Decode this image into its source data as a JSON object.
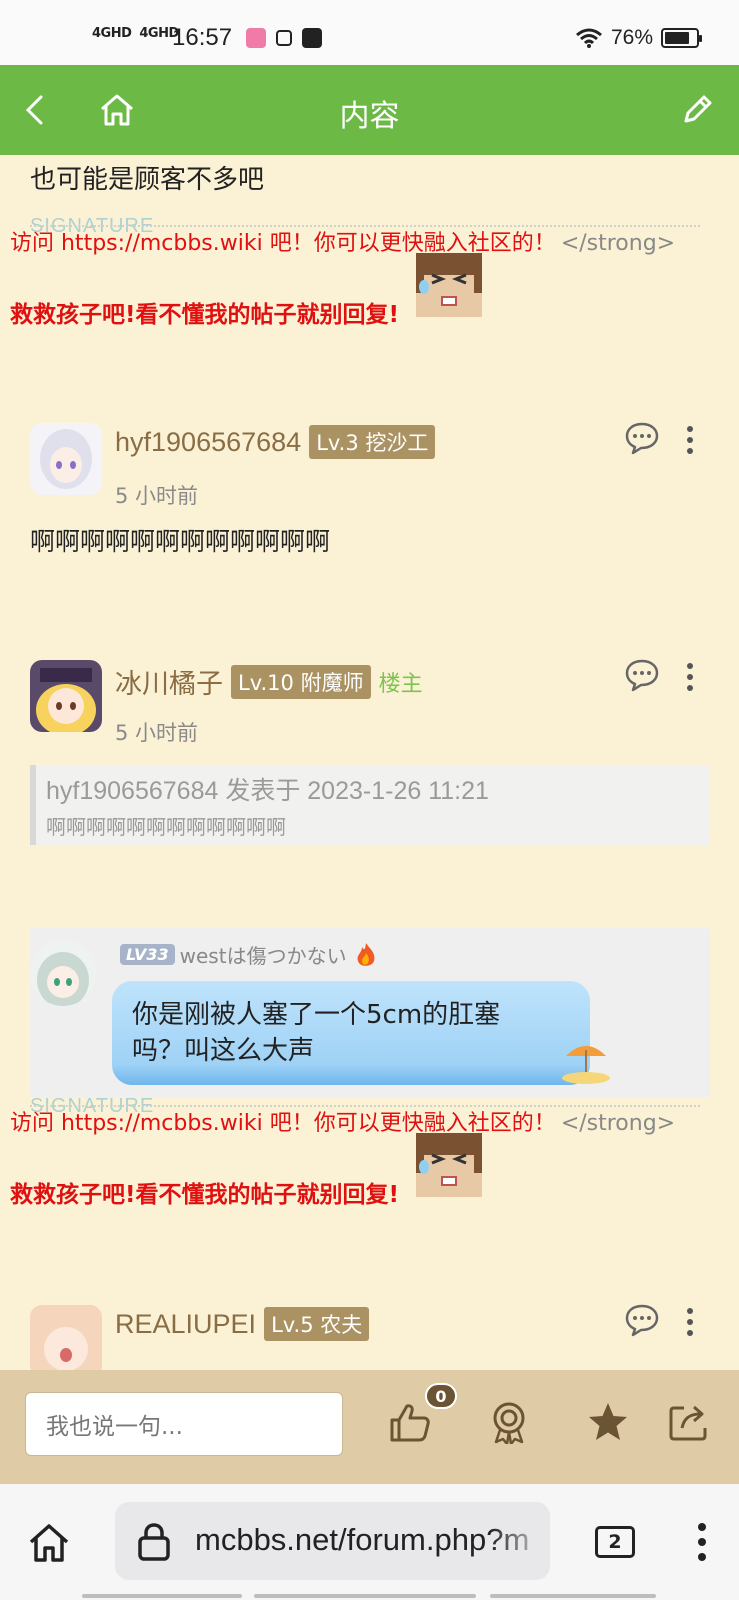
{
  "status_bar": {
    "network1": "4GHD",
    "network2": "4GHD",
    "time": "16:57",
    "battery": "76%"
  },
  "header": {
    "title": "内容"
  },
  "colors": {
    "header_green": "#6cba45",
    "page_bg": "#fbf2d6",
    "level_badge": "#ab9263",
    "signature_red": "#e01010",
    "reply_bar": "#dfcba5"
  },
  "posts": {
    "first": {
      "text": "也可能是顾客不多吧"
    },
    "signature": {
      "watermark": "SIGNATURE",
      "line1_red": "访问 https://mcbbs.wiki 吧！你可以更快融入社区的！",
      "line1_gray": "</strong>",
      "line2": "救救孩子吧!看不懂我的帖子就别回复!"
    },
    "reply1": {
      "username": "hyf1906567684",
      "level": "Lv.3 挖沙工",
      "time": "5 小时前",
      "text": "啊啊啊啊啊啊啊啊啊啊啊啊"
    },
    "reply2": {
      "username": "冰川橘子",
      "level": "Lv.10 附魔师",
      "owner_tag": "楼主",
      "time": "5 小时前",
      "quote_head": "hyf1906567684 发表于 2023-1-26 11:21",
      "quote_body": "啊啊啊啊啊啊啊啊啊啊啊啊",
      "chat_level": "LV33",
      "chat_name": "westは傷つかない",
      "bubble_line1": "你是刚被人塞了一个5cm的肛塞",
      "bubble_line2": "吗？叫这么大声"
    },
    "reply3": {
      "username": "REALIUPEI",
      "level": "Lv.5 农夫"
    }
  },
  "reply_bar": {
    "placeholder": "我也说一句...",
    "like_count": "0"
  },
  "browser": {
    "url": "mcbbs.net/forum.php?m",
    "tab_count": "2"
  }
}
